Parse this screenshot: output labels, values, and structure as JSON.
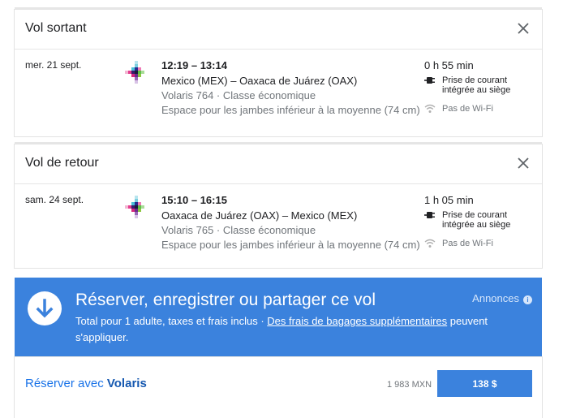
{
  "outbound": {
    "title": "Vol sortant",
    "date": "mer. 21 sept.",
    "times": "12:19 – 13:14",
    "route": "Mexico (MEX) – Oaxaca de Juárez (OAX)",
    "flight": "Volaris 764 · Classe économique",
    "legroom": "Espace pour les jambes inférieur à la moyenne (74 cm)",
    "duration": "0 h 55 min",
    "power": "Prise de courant intégrée au siège",
    "wifi": "Pas de Wi-Fi"
  },
  "return": {
    "title": "Vol de retour",
    "date": "sam. 24 sept.",
    "times": "15:10 – 16:15",
    "route": "Oaxaca de Juárez (OAX) – Mexico (MEX)",
    "flight": "Volaris 765 · Classe économique",
    "legroom": "Espace pour les jambes inférieur à la moyenne (74 cm)",
    "duration": "1 h 05 min",
    "power": "Prise de courant intégrée au siège",
    "wifi": "Pas de Wi-Fi"
  },
  "banner": {
    "title": "Réserver, enregistrer ou partager ce vol",
    "sub_before": "Total pour 1 adulte, taxes et frais inclus · ",
    "sub_link": "Des frais de bagages supplémentaires",
    "sub_after": " peuvent s'appliquer.",
    "ads": "Annonces",
    "info": "i"
  },
  "booking": {
    "label_prefix": "Réserver avec ",
    "airline": "Volaris",
    "mxn": "1 983 MXN",
    "price": "138 $"
  },
  "icons": {
    "close": "close-icon",
    "airline_logo": "volaris-logo-icon",
    "power": "power-plug-icon",
    "wifi": "no-wifi-icon",
    "download": "arrow-down-circle-icon"
  },
  "colors": {
    "accent": "#3b82dd",
    "link": "#1a73e8"
  }
}
